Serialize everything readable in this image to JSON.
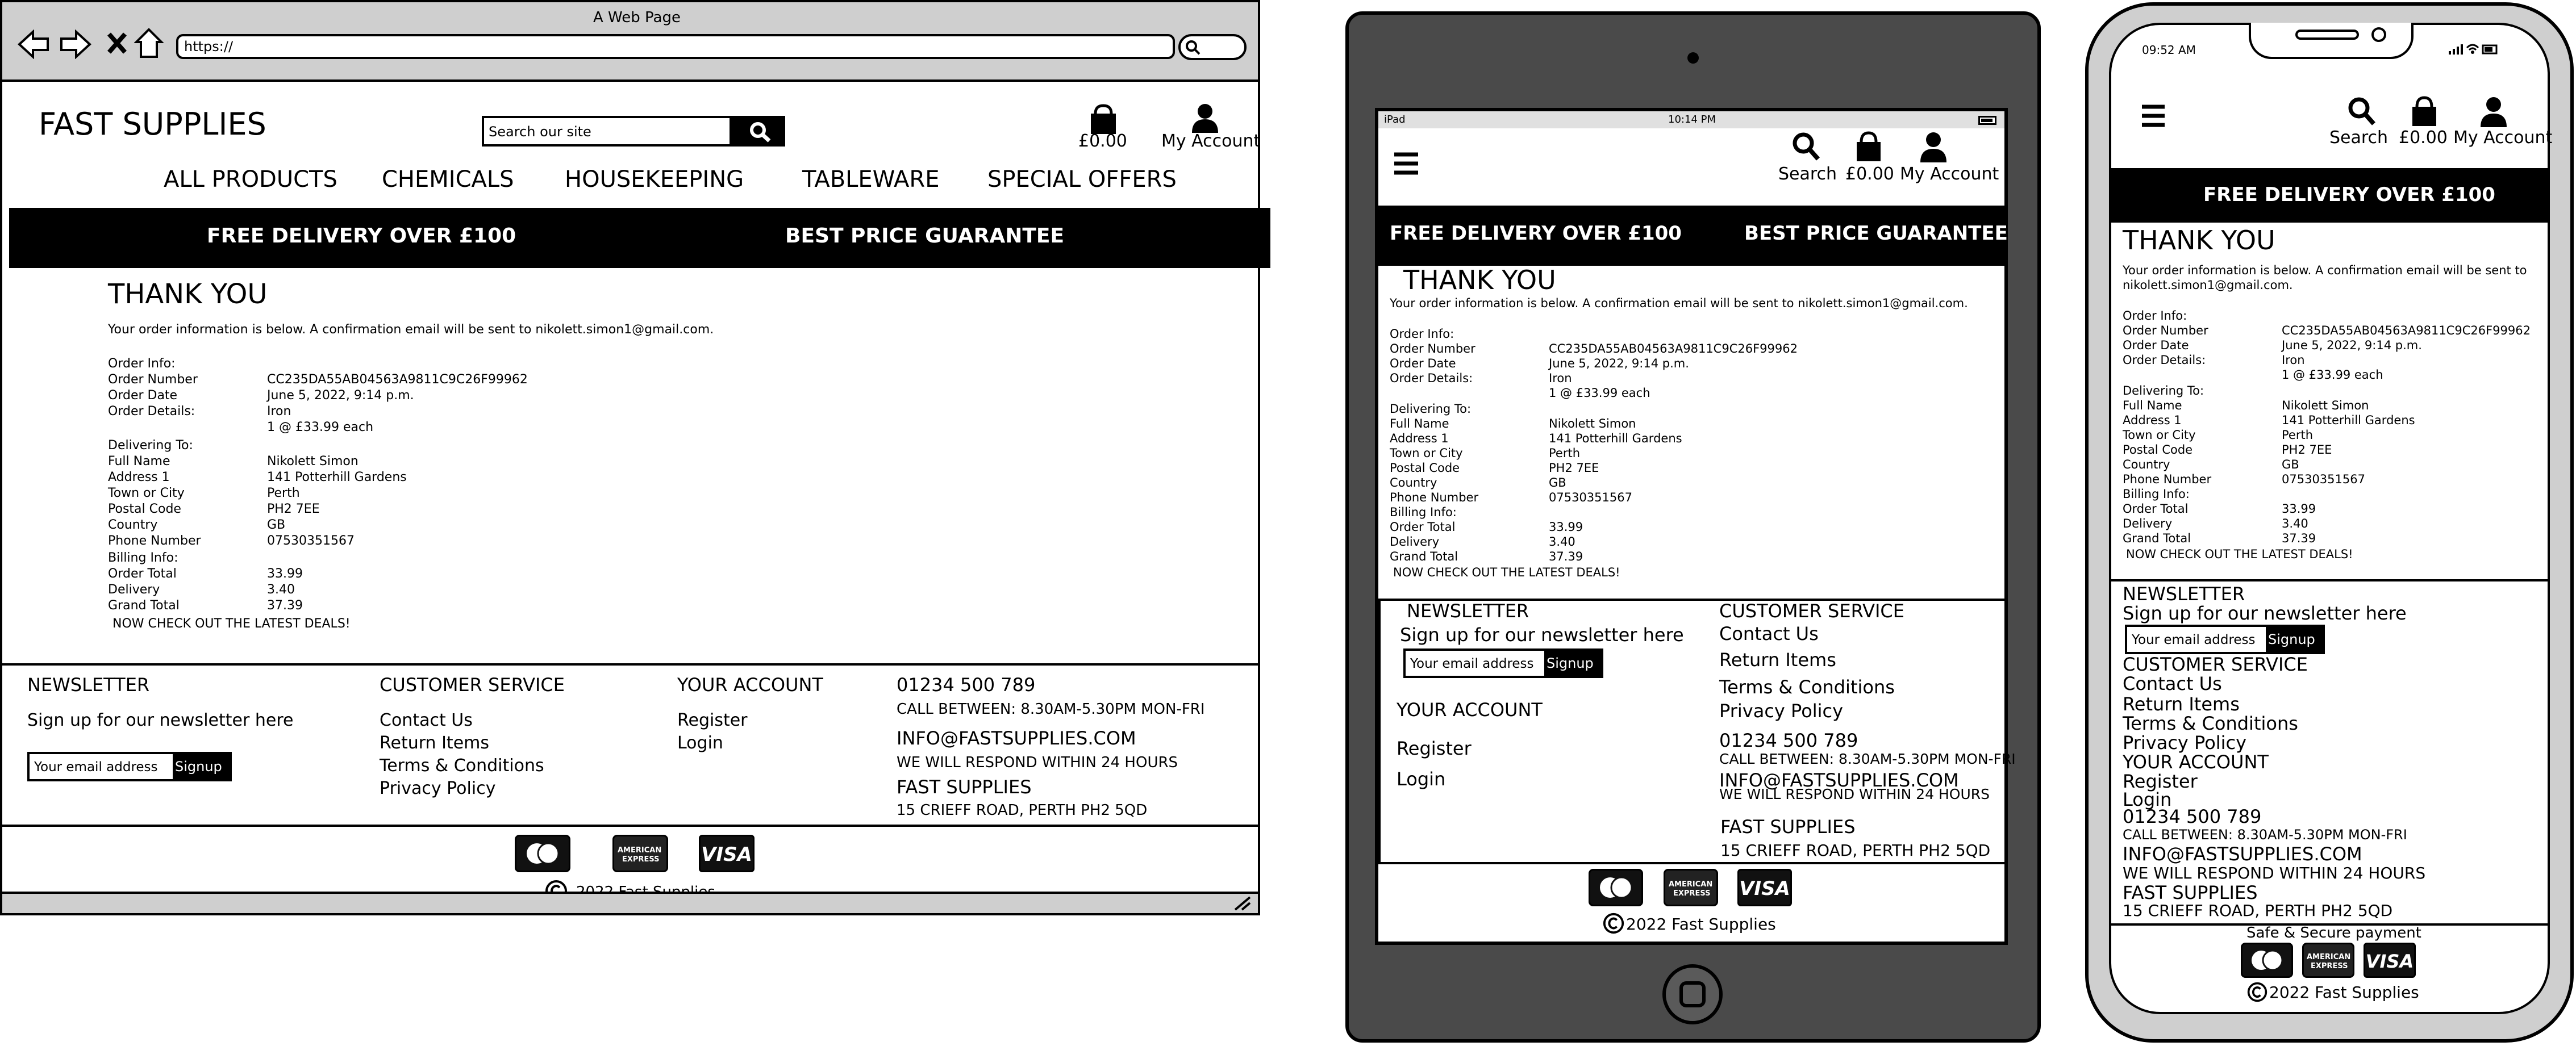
{
  "browser": {
    "title": "A Web Page",
    "url": "https://"
  },
  "site": {
    "brand": "FAST SUPPLIES",
    "search_placeholder": "Search our site",
    "cart_total": "£0.00",
    "account_label": "My Account",
    "search_label": "Search"
  },
  "nav": {
    "items": [
      "ALL PRODUCTS",
      "CHEMICALS",
      "HOUSEKEEPING",
      "TABLEWARE",
      "SPECIAL OFFERS"
    ]
  },
  "banner": {
    "left": "FREE DELIVERY OVER £100",
    "right": "BEST PRICE GUARANTEE"
  },
  "order": {
    "heading": "THANK YOU",
    "intro": "Your order information is below. A confirmation email will be sent to nikolett.simon1@gmail.com.",
    "intro_line1": "Your order information is below. A confirmation email will be sent to",
    "intro_line2": "nikolett.simon1@gmail.com.",
    "section_order": "Order Info:",
    "order_number_label": "Order Number",
    "order_number": "CC235DA55AB04563A9811C9C26F99962",
    "order_date_label": "Order Date",
    "order_date": "June 5, 2022, 9:14 p.m.",
    "order_details_label": "Order Details:",
    "item_name": "Iron",
    "item_qty": "1 @ £33.99 each",
    "section_delivery": "Delivering To:",
    "full_name_label": "Full Name",
    "full_name": "Nikolett Simon",
    "address_label": "Address 1",
    "address": "141 Potterhill Gardens",
    "town_label": "Town or City",
    "town": "Perth",
    "postal_label": "Postal Code",
    "postal": "PH2 7EE",
    "country_label": "Country",
    "country": "GB",
    "phone_label": "Phone Number",
    "phone": "07530351567",
    "section_billing": "Billing Info:",
    "order_total_label": "Order Total",
    "order_total": "33.99",
    "delivery_label": "Delivery",
    "delivery": "3.40",
    "grand_total_label": "Grand Total",
    "grand_total": "37.39",
    "cta": "NOW CHECK OUT THE LATEST DEALS!"
  },
  "footer": {
    "newsletter_title": "NEWSLETTER",
    "newsletter_text": "Sign up for our newsletter here",
    "email_placeholder": "Your email address",
    "signup": "Signup",
    "customer_service_title": "CUSTOMER SERVICE",
    "cs_links": [
      "Contact Us",
      "Return Items",
      "Terms & Conditions",
      "Privacy Policy"
    ],
    "account_title": "YOUR ACCOUNT",
    "account_links": [
      "Register",
      "Login"
    ],
    "phone": "01234 500 789",
    "call_hours": "CALL BETWEEN: 8.30AM-5.30PM MON-FRI",
    "email": "INFO@FASTSUPPLIES.COM",
    "respond": "WE WILL RESPOND WITHIN 24 HOURS",
    "company": "FAST SUPPLIES",
    "address": "15 CRIEFF ROAD, PERTH PH2 5QD",
    "copyright": "2022 Fast Supplies",
    "secure": "Safe & Secure payment",
    "amex_line1": "AMERICAN",
    "amex_line2": "EXPRESS",
    "visa": "VISA"
  },
  "tablet": {
    "status_left": "iPad",
    "status_time": "10:14 PM"
  },
  "phone": {
    "status_time": "09:52 AM"
  },
  "colors": {
    "banner": "#000000",
    "tablet_frame": "#4a4a4a",
    "phone_frame": "#cfcfcf",
    "browser_chrome": "#cfcfcf"
  }
}
